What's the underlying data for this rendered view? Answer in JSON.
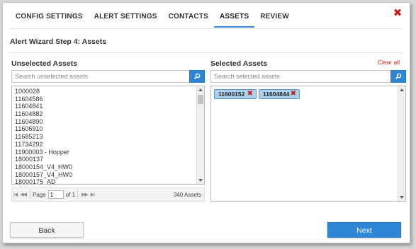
{
  "tabs": [
    {
      "label": "CONFIG SETTINGS"
    },
    {
      "label": "ALERT SETTINGS"
    },
    {
      "label": "CONTACTS"
    },
    {
      "label": "ASSETS"
    },
    {
      "label": "REVIEW"
    }
  ],
  "active_tab": "ASSETS",
  "step_title": "Alert Wizard Step 4: Assets",
  "unselected": {
    "title": "Unselected Assets",
    "search_placeholder": "Search unselected assets",
    "items": [
      "1000028",
      "11604586",
      "11604841",
      "11604882",
      "11604890",
      "11606910",
      "11685213",
      "11734292",
      "11900003 - Hopper",
      "18000137",
      "18000154_V4_HW0",
      "18000157_V4_HW0",
      "18000175_AD"
    ],
    "pager": {
      "page_label": "Page",
      "page_value": "1",
      "of_label": "of 1",
      "count_label": "340 Assets"
    }
  },
  "selected": {
    "title": "Selected Assets",
    "clear_label": "Clear all",
    "search_placeholder": "Search selected assets",
    "chips": [
      {
        "label": "11600152"
      },
      {
        "label": "11604844"
      }
    ]
  },
  "buttons": {
    "back": "Back",
    "next": "Next"
  },
  "colors": {
    "accent": "#2e86d4",
    "danger": "#c0201c",
    "chip_bg": "#aed2ee"
  }
}
